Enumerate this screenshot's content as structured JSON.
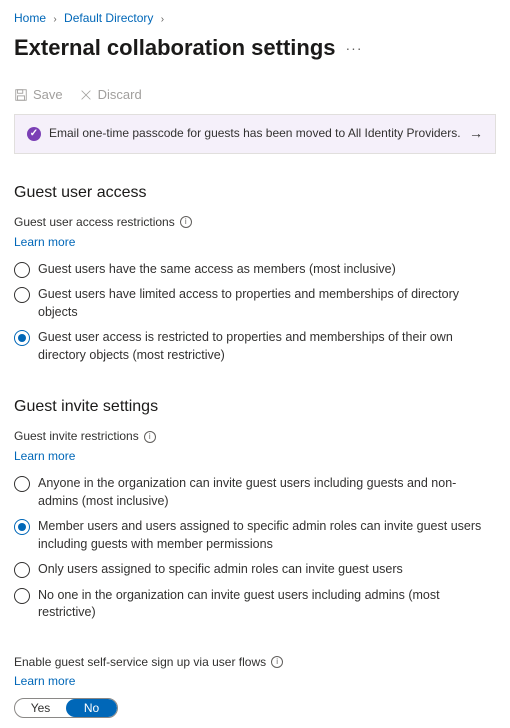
{
  "breadcrumb": {
    "items": [
      {
        "label": "Home"
      },
      {
        "label": "Default Directory"
      }
    ]
  },
  "page": {
    "title": "External collaboration settings"
  },
  "toolbar": {
    "save": "Save",
    "discard": "Discard"
  },
  "banner": {
    "text": "Email one-time passcode for guests has been moved to All Identity Providers."
  },
  "guest_access": {
    "section_title": "Guest user access",
    "sub_label": "Guest user access restrictions",
    "learn_more": "Learn more",
    "selected_index": 2,
    "options": [
      "Guest users have the same access as members (most inclusive)",
      "Guest users have limited access to properties and memberships of directory objects",
      "Guest user access is restricted to properties and memberships of their own directory objects (most restrictive)"
    ]
  },
  "guest_invite": {
    "section_title": "Guest invite settings",
    "sub_label": "Guest invite restrictions",
    "learn_more": "Learn more",
    "selected_index": 1,
    "options": [
      "Anyone in the organization can invite guest users including guests and non-admins (most inclusive)",
      "Member users and users assigned to specific admin roles can invite guest users including guests with member permissions",
      "Only users assigned to specific admin roles can invite guest users",
      "No one in the organization can invite guest users including admins (most restrictive)"
    ]
  },
  "self_service": {
    "label": "Enable guest self-service sign up via user flows",
    "learn_more": "Learn more",
    "toggle": {
      "yes": "Yes",
      "no": "No",
      "value": "No"
    }
  }
}
